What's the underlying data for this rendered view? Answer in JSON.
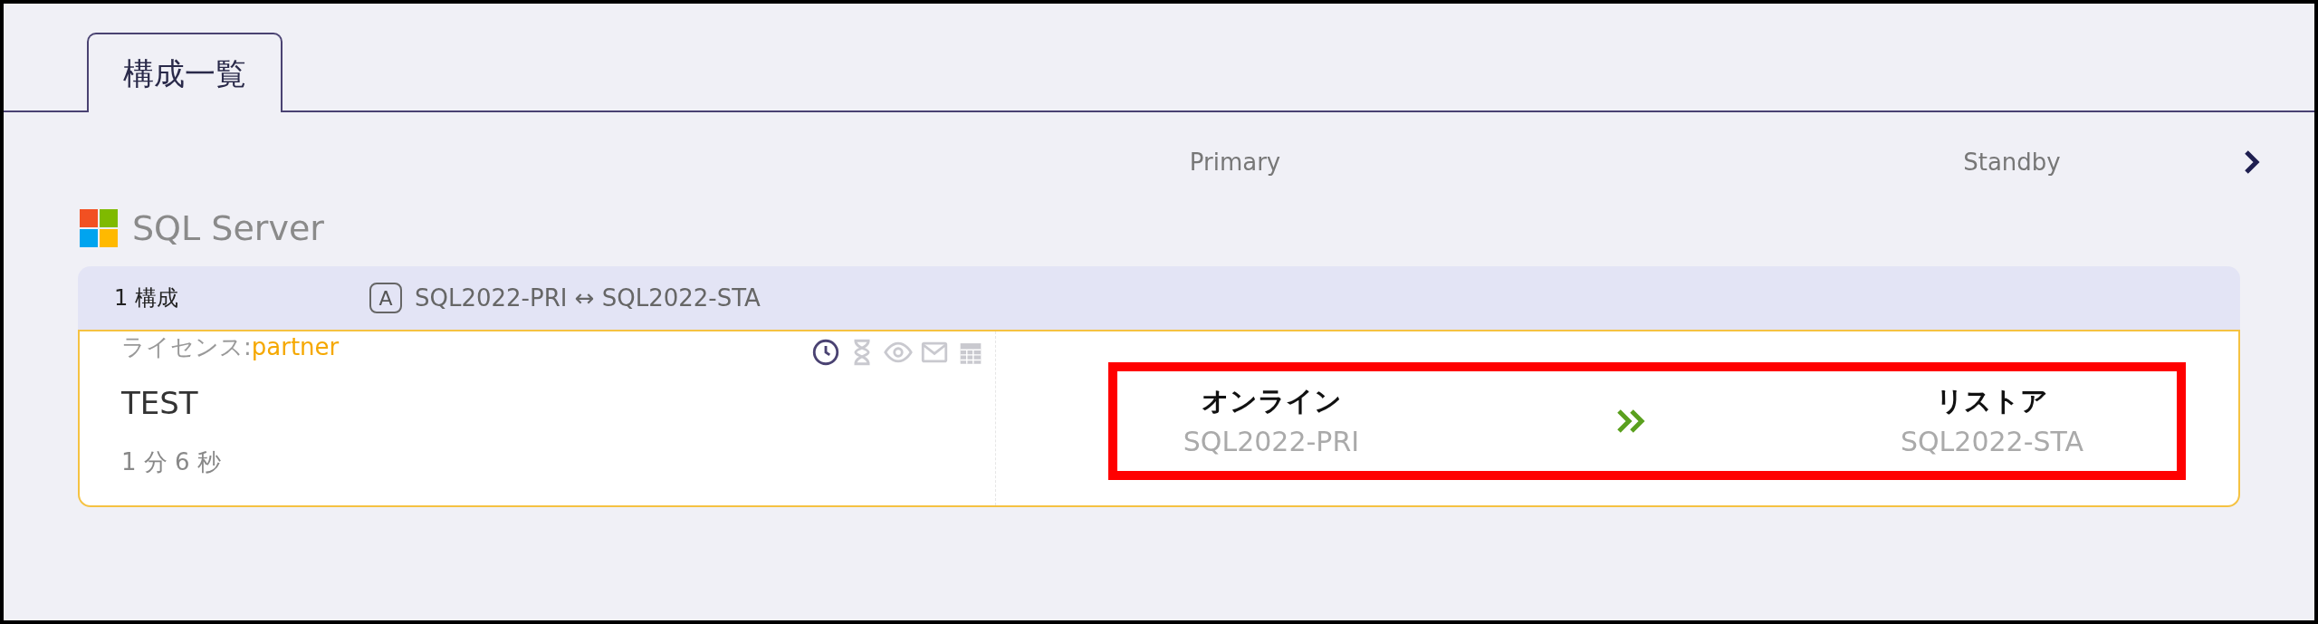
{
  "tabs": [
    {
      "label": "構成一覧",
      "selected": true
    }
  ],
  "columns": {
    "primary": "Primary",
    "standby": "Standby"
  },
  "product": {
    "name": "SQL Server"
  },
  "group": {
    "count": "1 構成",
    "mode_badge": "A",
    "pair": "SQL2022-PRI ↔ SQL2022-STA"
  },
  "item": {
    "license_label": "ライセンス:",
    "license_value": "partner",
    "name": "TEST",
    "elapsed": "1 分 6 秒",
    "icons": [
      {
        "kind": "clock",
        "active": true
      },
      {
        "kind": "hourglass",
        "active": false
      },
      {
        "kind": "eye",
        "active": false
      },
      {
        "kind": "mail",
        "active": false
      },
      {
        "kind": "calendar",
        "active": false
      }
    ],
    "primary": {
      "status": "オンライン",
      "host": "SQL2022-PRI"
    },
    "standby": {
      "status": "リストア",
      "host": "SQL2022-STA"
    }
  }
}
